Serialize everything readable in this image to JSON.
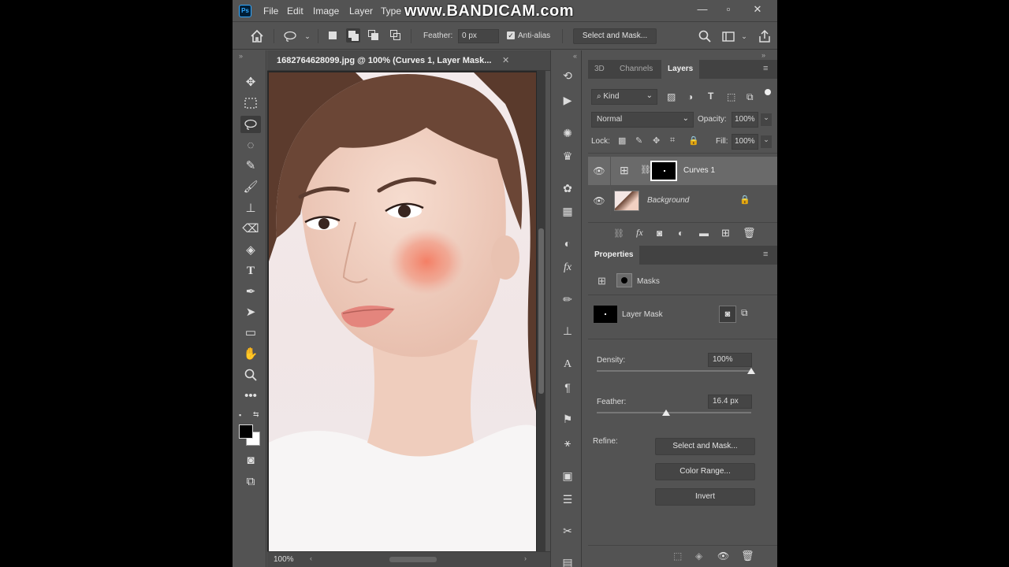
{
  "app": {
    "logo": "Ps",
    "watermark": "www.BANDICAM.com"
  },
  "menu": {
    "items": [
      "File",
      "Edit",
      "Image",
      "Layer",
      "Type"
    ]
  },
  "options": {
    "feather_label": "Feather:",
    "feather_value": "0 px",
    "anti_alias_label": "Anti-alias",
    "select_mask_label": "Select and Mask..."
  },
  "document": {
    "tab_title": "1682764628099.jpg @ 100% (Curves 1, Layer Mask...",
    "zoom": "100%"
  },
  "layers_panel": {
    "tabs": [
      "3D",
      "Channels",
      "Layers"
    ],
    "active_tab": "Layers",
    "filter_kind": "Kind",
    "blend_mode": "Normal",
    "opacity_label": "Opacity:",
    "opacity_value": "100%",
    "lock_label": "Lock:",
    "fill_label": "Fill:",
    "fill_value": "100%",
    "layers": [
      {
        "name": "Curves 1",
        "selected": true
      },
      {
        "name": "Background",
        "selected": false
      }
    ]
  },
  "properties_panel": {
    "title": "Properties",
    "section": "Masks",
    "mask_name": "Layer Mask",
    "density_label": "Density:",
    "density_value": "100%",
    "density_level": 1.0,
    "feather_label": "Feather:",
    "feather_value": "16.4 px",
    "feather_level": 0.45,
    "refine_label": "Refine:",
    "buttons": [
      "Select and Mask...",
      "Color Range...",
      "Invert"
    ]
  },
  "colors": {
    "ui_bg": "#535353",
    "panel_tab_bg": "#424242",
    "accent": "#31a8ff",
    "foreground_swatch": "#000000",
    "background_swatch": "#ffffff"
  }
}
